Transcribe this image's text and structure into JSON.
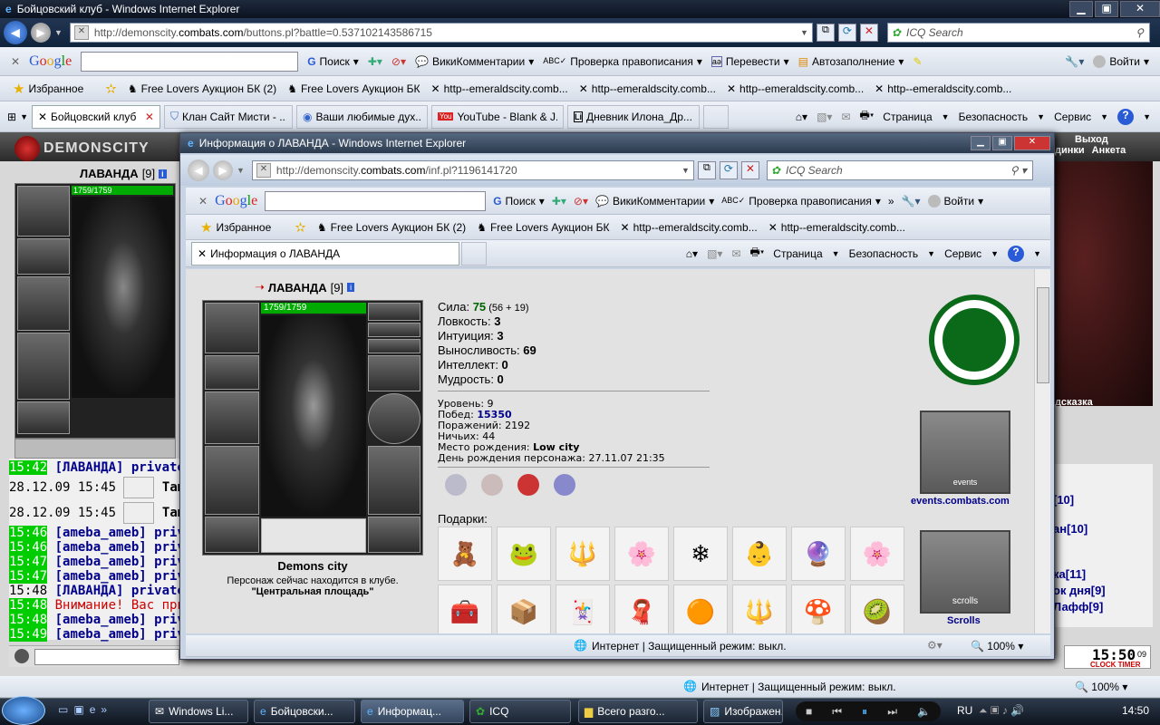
{
  "outer": {
    "title": "Бойцовский клуб - Windows Internet Explorer",
    "url_prefix": "http://demonscity.",
    "url_host": "combats.com",
    "url_rest": "/buttons.pl?battle=0.537102143586715",
    "icq_search": "ICQ Search",
    "google_toolbar": [
      "Поиск",
      "ВикиКомментарии",
      "Проверка правописания",
      "Перевести",
      "Автозаполнение",
      "Войти"
    ],
    "favorites_label": "Избранное",
    "favorites": [
      "Free Lovers  Аукцион БК (2)",
      "Free Lovers  Аукцион БК",
      "http--emeraldscity.comb...",
      "http--emeraldscity.comb...",
      "http--emeraldscity.comb...",
      "http--emeraldscity.comb..."
    ],
    "tabs": [
      "Бойцовский клуб",
      "Клан Сайт Мисти - ...",
      "Ваши любимые дух...",
      "YouTube - Blank & J...",
      "Дневник Илона_Др..."
    ],
    "cmd": [
      "Страница",
      "Безопасность",
      "Сервис"
    ],
    "status": "Интернет | Защищенный режим: выкл.",
    "zoom": "100%"
  },
  "game": {
    "logo": "DEMONSCITY",
    "exit": "Выход",
    "links": [
      "динки",
      "Анкета"
    ],
    "char_name": "ЛАВАНДА",
    "level": "[9]",
    "hp": "1759/1759",
    "hint": "дсказка",
    "chat": [
      {
        "time": "15:42",
        "text": "[ЛАВАНДА] private",
        "hl": true
      },
      {
        "time": "28.12.09 15:45",
        "text": "Там",
        "hl": false
      },
      {
        "time": "28.12.09 15:45",
        "text": "Там",
        "hl": false
      },
      {
        "time": "15:46",
        "text": "[ameba_ameb] priv",
        "hl": true
      },
      {
        "time": "15:46",
        "text": "[ameba_ameb] priv",
        "hl": true
      },
      {
        "time": "15:47",
        "text": "[ameba_ameb] priv",
        "hl": true
      },
      {
        "time": "15:47",
        "text": "[ameba_ameb] priv",
        "hl": true
      },
      {
        "time": "15:48",
        "text": "[ЛАВАНДА] private",
        "hl": false
      },
      {
        "time": "15:48",
        "text": "Внимание! Вас приве",
        "hl": true
      },
      {
        "time": "15:48",
        "text": "[ameba_ameb] priv",
        "hl": true
      },
      {
        "time": "15:49",
        "text": "[ameba_ameb] priv",
        "hl": true
      }
    ],
    "right_list": [
      "",
      "",
      "[10]",
      "",
      "ан[10]",
      "",
      "",
      "ка[11]",
      "ок дня[9]",
      "Лафф[9]"
    ],
    "clock": "15:50",
    "clock_sec": "09",
    "clock_label": "CLOCK TIMER"
  },
  "popup": {
    "title": "Информация о ЛАВАНДА - Windows Internet Explorer",
    "url_prefix": "http://demonscity.",
    "url_host": "combats.com",
    "url_rest": "/inf.pl?1196141720",
    "icq_search": "ICQ Search",
    "google_toolbar": [
      "Поиск",
      "ВикиКомментарии",
      "Проверка правописания",
      "Войти"
    ],
    "favorites_label": "Избранное",
    "favorites": [
      "Free Lovers  Аукцион БК (2)",
      "Free Lovers  Аукцион БК",
      "http--emeraldscity.comb...",
      "http--emeraldscity.comb..."
    ],
    "tab": "Информация о ЛАВАНДА",
    "cmd": [
      "Страница",
      "Безопасность",
      "Сервис"
    ],
    "status": "Интернет | Защищенный режим: выкл.",
    "zoom": "100%",
    "char": {
      "name": "ЛАВАНДА",
      "level": "[9]",
      "hp": "1759/1759",
      "city": "Demons city",
      "location_text": "Персонаж сейчас находится в клубе.",
      "location": "\"Центральная площадь\""
    },
    "stats": [
      {
        "label": "Сила: ",
        "value": "75",
        "extra": " (56 + 19)"
      },
      {
        "label": "Ловкость: ",
        "value": "3",
        "extra": ""
      },
      {
        "label": "Интуиция: ",
        "value": "3",
        "extra": ""
      },
      {
        "label": "Выносливость: ",
        "value": "69",
        "extra": ""
      },
      {
        "label": "Интеллект: ",
        "value": "0",
        "extra": ""
      },
      {
        "label": "Мудрость: ",
        "value": "0",
        "extra": ""
      }
    ],
    "info": {
      "level": "Уровень: 9",
      "wins_label": "Побед: ",
      "wins": "15350",
      "losses": "Поражений: 2192",
      "draws": "Ничьих: 44",
      "birthplace_label": "Место рождения: ",
      "birthplace": "Low city",
      "birthday": "День рождения персонажа: 27.11.07 21:35"
    },
    "gifts_label": "Подарки:",
    "gifts": [
      "🧸",
      "🐸",
      "🔱",
      "🌸",
      "❄",
      "👶",
      "🔮",
      "🌸",
      "🧰",
      "📦",
      "🃏",
      "🧣",
      "🟠",
      "🔱",
      "🍄",
      "🥝"
    ],
    "events_link": "events.combats.com",
    "scrolls_link": "Scrolls",
    "events_label": "events",
    "scrolls_label": "scrolls"
  },
  "taskbar": {
    "items": [
      "Windows Li...",
      "Бойцовски...",
      "Информац...",
      "ICQ",
      "Всего разго...",
      "Изображен..."
    ],
    "lang": "RU",
    "time": "14:50"
  }
}
